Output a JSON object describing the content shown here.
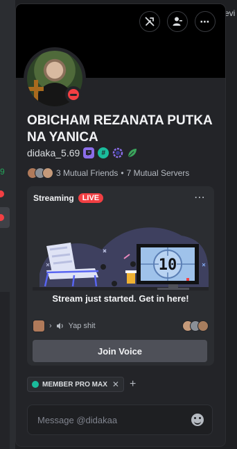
{
  "background": {
    "peek_text": "evi",
    "peek_text_2": "9"
  },
  "profile": {
    "display_name": "OBICHAM REZANATA PUTKA NA YANICA",
    "username": "didaka_5.69",
    "status": "do-not-disturb",
    "badges": [
      "twitch-badge",
      "hypesquad-badge",
      "nitro-badge",
      "leaf-badge"
    ],
    "mutual_friends": "3 Mutual Friends",
    "mutual_servers": "7 Mutual Servers",
    "separator": "•"
  },
  "top_buttons": [
    "no-voice-icon",
    "add-friend-icon",
    "more-icon"
  ],
  "stream": {
    "label": "Streaming",
    "live": "LIVE",
    "countdown": "10",
    "message": "Stream just started. Get in here!",
    "channel": "Yap shit",
    "join_label": "Join Voice"
  },
  "roles": [
    {
      "name": "MEMBER PRO MAX",
      "color": "#1abc9c"
    }
  ],
  "message_box": {
    "placeholder": "Message @didakaa"
  },
  "colors": {
    "accent_red": "#f23f43",
    "role_teal": "#1abc9c",
    "nitro_purple": "#8b6de8"
  }
}
